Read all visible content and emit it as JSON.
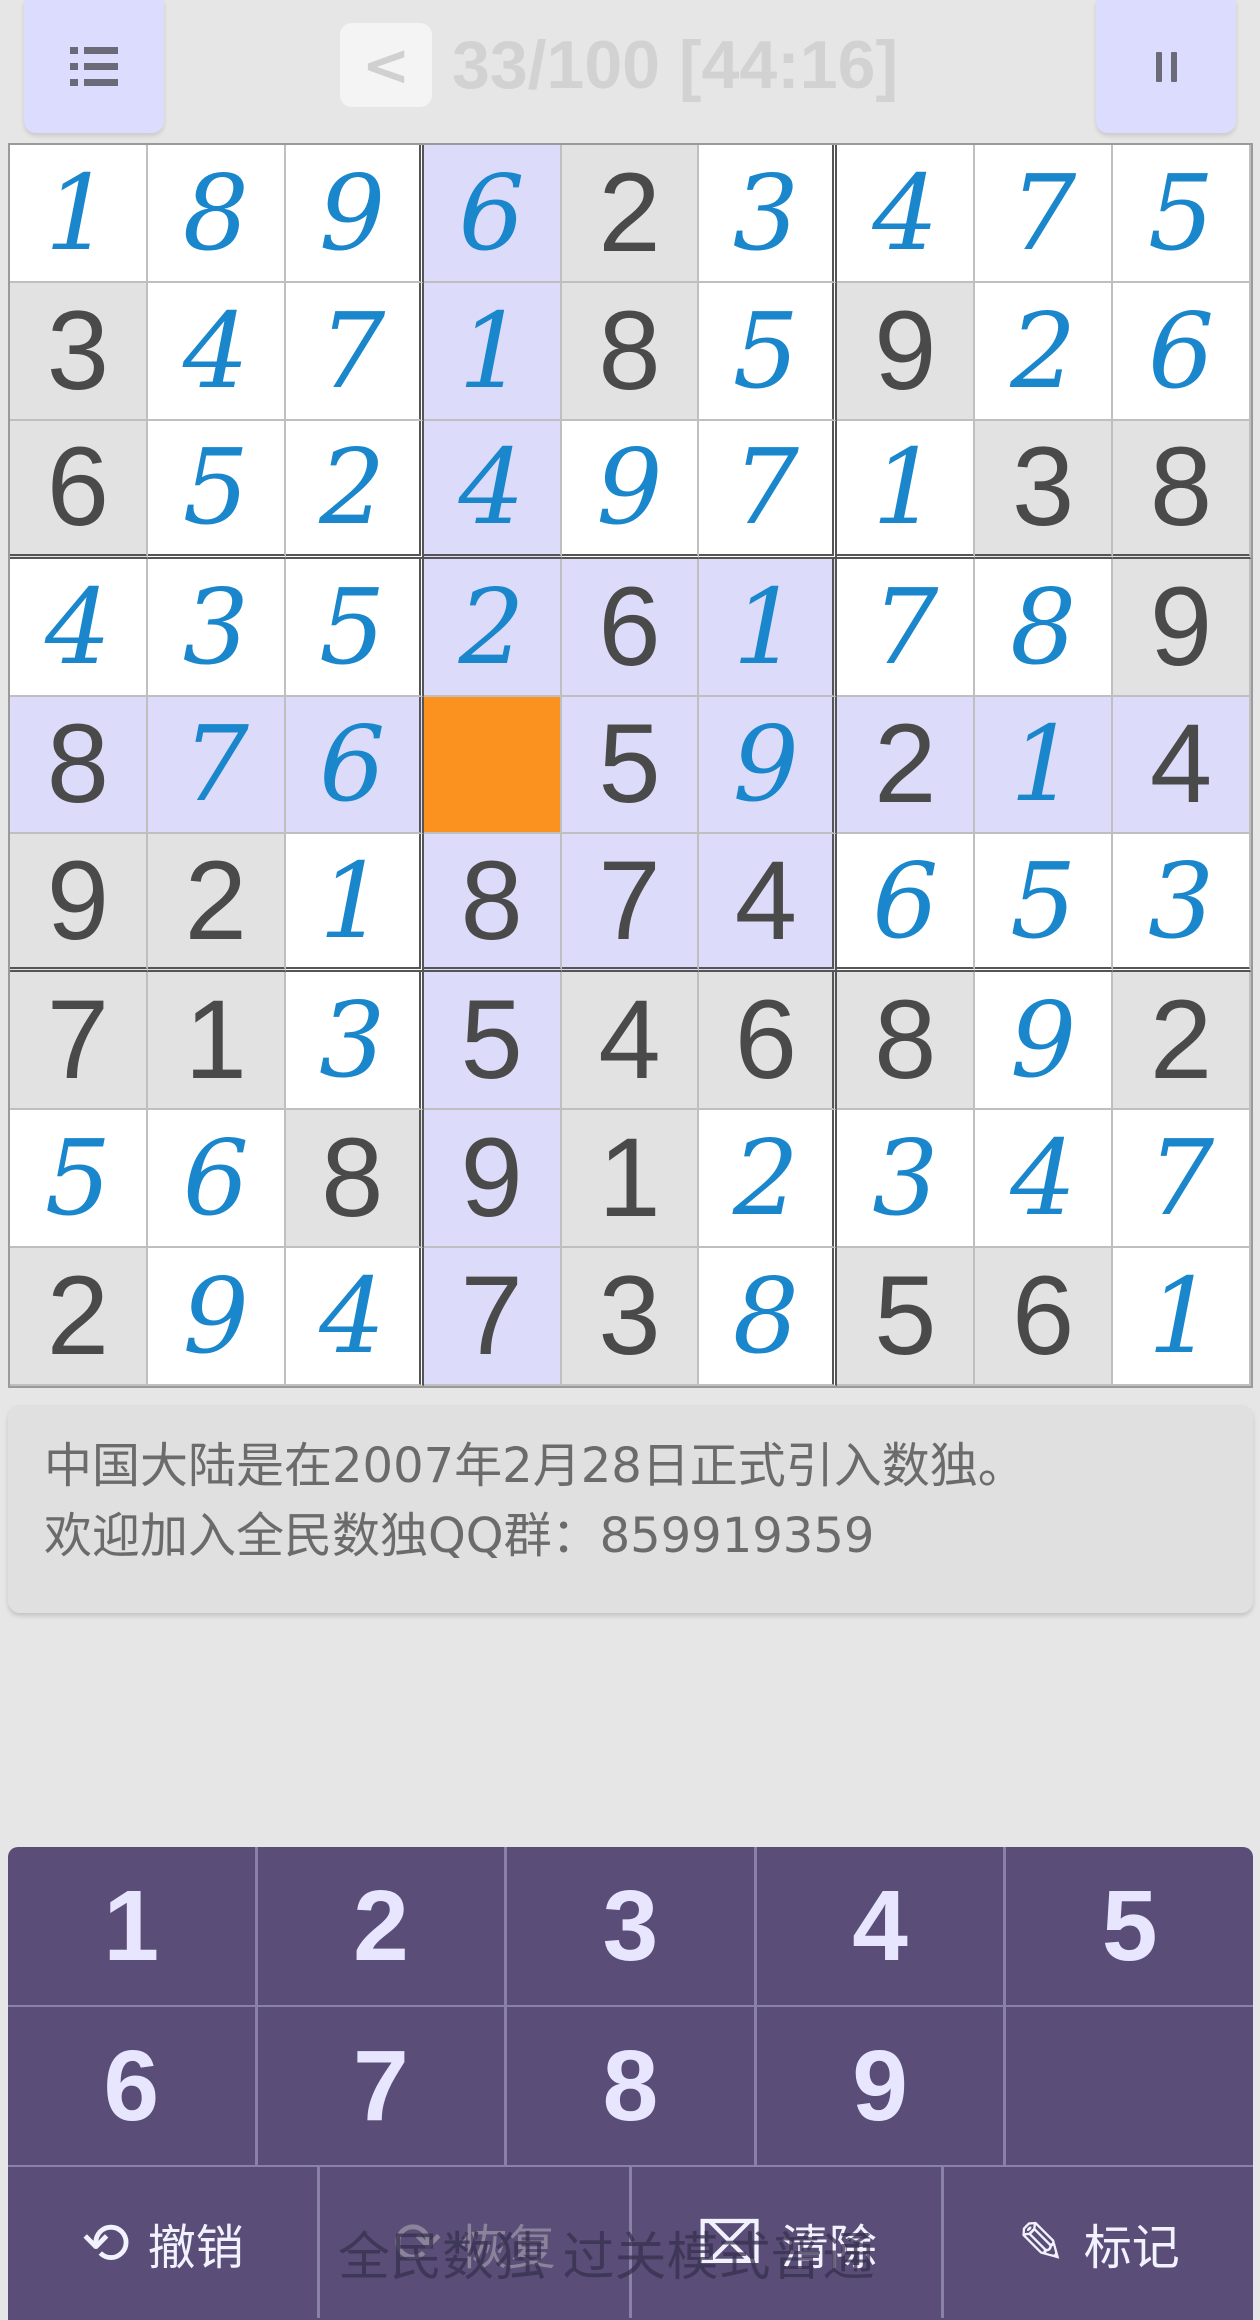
{
  "header": {
    "menu_icon": "list-menu-icon",
    "back_label": "<",
    "title": "33/100 [44:16]",
    "pause_icon": "pause-icon"
  },
  "board": {
    "rows": [
      [
        {
          "v": "1",
          "t": "user",
          "bg": "w"
        },
        {
          "v": "8",
          "t": "user",
          "bg": "w"
        },
        {
          "v": "9",
          "t": "user",
          "bg": "w"
        },
        {
          "v": "6",
          "t": "user",
          "bg": "h"
        },
        {
          "v": "2",
          "t": "given",
          "bg": "g"
        },
        {
          "v": "3",
          "t": "user",
          "bg": "w"
        },
        {
          "v": "4",
          "t": "user",
          "bg": "w"
        },
        {
          "v": "7",
          "t": "user",
          "bg": "w"
        },
        {
          "v": "5",
          "t": "user",
          "bg": "w"
        }
      ],
      [
        {
          "v": "3",
          "t": "given",
          "bg": "g"
        },
        {
          "v": "4",
          "t": "user",
          "bg": "w"
        },
        {
          "v": "7",
          "t": "user",
          "bg": "w"
        },
        {
          "v": "1",
          "t": "user",
          "bg": "h"
        },
        {
          "v": "8",
          "t": "given",
          "bg": "g"
        },
        {
          "v": "5",
          "t": "user",
          "bg": "w"
        },
        {
          "v": "9",
          "t": "given",
          "bg": "g"
        },
        {
          "v": "2",
          "t": "user",
          "bg": "w"
        },
        {
          "v": "6",
          "t": "user",
          "bg": "w"
        }
      ],
      [
        {
          "v": "6",
          "t": "given",
          "bg": "g"
        },
        {
          "v": "5",
          "t": "user",
          "bg": "w"
        },
        {
          "v": "2",
          "t": "user",
          "bg": "w"
        },
        {
          "v": "4",
          "t": "user",
          "bg": "h"
        },
        {
          "v": "9",
          "t": "user",
          "bg": "w"
        },
        {
          "v": "7",
          "t": "user",
          "bg": "w"
        },
        {
          "v": "1",
          "t": "user",
          "bg": "w"
        },
        {
          "v": "3",
          "t": "given",
          "bg": "g"
        },
        {
          "v": "8",
          "t": "given",
          "bg": "g"
        }
      ],
      [
        {
          "v": "4",
          "t": "user",
          "bg": "w"
        },
        {
          "v": "3",
          "t": "user",
          "bg": "w"
        },
        {
          "v": "5",
          "t": "user",
          "bg": "w"
        },
        {
          "v": "2",
          "t": "user",
          "bg": "h"
        },
        {
          "v": "6",
          "t": "given",
          "bg": "h"
        },
        {
          "v": "1",
          "t": "user",
          "bg": "h"
        },
        {
          "v": "7",
          "t": "user",
          "bg": "w"
        },
        {
          "v": "8",
          "t": "user",
          "bg": "w"
        },
        {
          "v": "9",
          "t": "given",
          "bg": "g"
        }
      ],
      [
        {
          "v": "8",
          "t": "given",
          "bg": "h"
        },
        {
          "v": "7",
          "t": "user",
          "bg": "h"
        },
        {
          "v": "6",
          "t": "user",
          "bg": "h"
        },
        {
          "v": "",
          "t": "empty",
          "bg": "s"
        },
        {
          "v": "5",
          "t": "given",
          "bg": "h"
        },
        {
          "v": "9",
          "t": "user",
          "bg": "h"
        },
        {
          "v": "2",
          "t": "given",
          "bg": "h"
        },
        {
          "v": "1",
          "t": "user",
          "bg": "h"
        },
        {
          "v": "4",
          "t": "given",
          "bg": "h"
        }
      ],
      [
        {
          "v": "9",
          "t": "given",
          "bg": "g"
        },
        {
          "v": "2",
          "t": "given",
          "bg": "g"
        },
        {
          "v": "1",
          "t": "user",
          "bg": "w"
        },
        {
          "v": "8",
          "t": "given",
          "bg": "h"
        },
        {
          "v": "7",
          "t": "given",
          "bg": "h"
        },
        {
          "v": "4",
          "t": "given",
          "bg": "h"
        },
        {
          "v": "6",
          "t": "user",
          "bg": "w"
        },
        {
          "v": "5",
          "t": "user",
          "bg": "w"
        },
        {
          "v": "3",
          "t": "user",
          "bg": "w"
        }
      ],
      [
        {
          "v": "7",
          "t": "given",
          "bg": "g"
        },
        {
          "v": "1",
          "t": "given",
          "bg": "g"
        },
        {
          "v": "3",
          "t": "user",
          "bg": "w"
        },
        {
          "v": "5",
          "t": "given",
          "bg": "h"
        },
        {
          "v": "4",
          "t": "given",
          "bg": "g"
        },
        {
          "v": "6",
          "t": "given",
          "bg": "g"
        },
        {
          "v": "8",
          "t": "given",
          "bg": "g"
        },
        {
          "v": "9",
          "t": "user",
          "bg": "w"
        },
        {
          "v": "2",
          "t": "given",
          "bg": "g"
        }
      ],
      [
        {
          "v": "5",
          "t": "user",
          "bg": "w"
        },
        {
          "v": "6",
          "t": "user",
          "bg": "w"
        },
        {
          "v": "8",
          "t": "given",
          "bg": "g"
        },
        {
          "v": "9",
          "t": "given",
          "bg": "h"
        },
        {
          "v": "1",
          "t": "given",
          "bg": "g"
        },
        {
          "v": "2",
          "t": "user",
          "bg": "w"
        },
        {
          "v": "3",
          "t": "user",
          "bg": "w"
        },
        {
          "v": "4",
          "t": "user",
          "bg": "w"
        },
        {
          "v": "7",
          "t": "user",
          "bg": "w"
        }
      ],
      [
        {
          "v": "2",
          "t": "given",
          "bg": "g"
        },
        {
          "v": "9",
          "t": "user",
          "bg": "w"
        },
        {
          "v": "4",
          "t": "user",
          "bg": "w"
        },
        {
          "v": "7",
          "t": "given",
          "bg": "h"
        },
        {
          "v": "3",
          "t": "given",
          "bg": "g"
        },
        {
          "v": "8",
          "t": "user",
          "bg": "w"
        },
        {
          "v": "5",
          "t": "given",
          "bg": "g"
        },
        {
          "v": "6",
          "t": "given",
          "bg": "g"
        },
        {
          "v": "1",
          "t": "user",
          "bg": "w"
        }
      ]
    ]
  },
  "tip": {
    "line1": "中国大陆是在2007年2月28日正式引入数独。",
    "line2": "欢迎加入全民数独QQ群：859919359"
  },
  "keypad": {
    "numbers": [
      "1",
      "2",
      "3",
      "4",
      "5",
      "6",
      "7",
      "8",
      "9"
    ],
    "actions": [
      {
        "label": "撤销",
        "icon": "undo-icon",
        "glyph": "⟲",
        "enabled": true
      },
      {
        "label": "恢复",
        "icon": "redo-icon",
        "glyph": "⟳",
        "enabled": false
      },
      {
        "label": "清除",
        "icon": "trash-icon",
        "glyph": "🗑",
        "enabled": true
      },
      {
        "label": "标记",
        "icon": "pencil-icon",
        "glyph": "✎",
        "enabled": true
      }
    ],
    "watermark": "全民数独 过关模式普通"
  },
  "colors": {
    "user_digit": "#1a86cc",
    "given_digit": "#4a4a4a",
    "highlight": "#dcdcfa",
    "selected": "#fb9220",
    "keypad_bg": "#5a4e78"
  }
}
